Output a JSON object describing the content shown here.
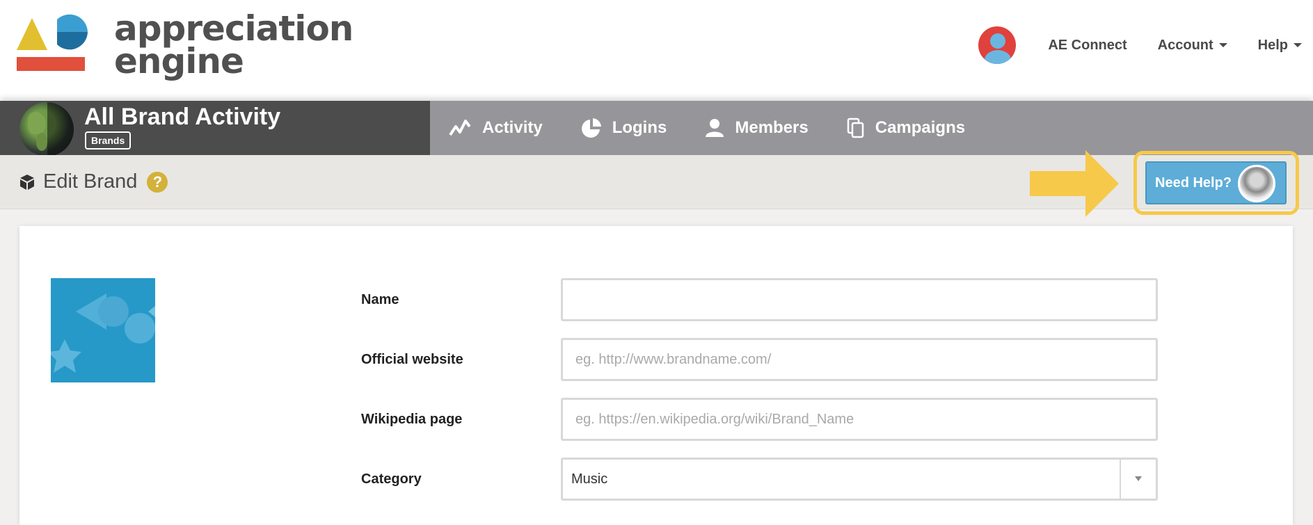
{
  "header": {
    "logo_line1": "appreciation",
    "logo_line2": "engine",
    "links": [
      {
        "label": "AE Connect",
        "caret": false
      },
      {
        "label": "Account",
        "caret": true
      },
      {
        "label": "Help",
        "caret": true
      }
    ]
  },
  "brand": {
    "title": "All Brand Activity",
    "badge": "Brands"
  },
  "nav": {
    "items": [
      {
        "label": "Activity",
        "icon": "activity-icon"
      },
      {
        "label": "Logins",
        "icon": "pie-chart-icon"
      },
      {
        "label": "Members",
        "icon": "person-icon"
      },
      {
        "label": "Campaigns",
        "icon": "copy-icon"
      }
    ]
  },
  "subheader": {
    "title": "Edit Brand",
    "help_glyph": "?",
    "need_help": "Need Help?"
  },
  "form": {
    "name_label": "Name",
    "name_value": "",
    "website_label": "Official website",
    "website_placeholder": "eg. http://www.brandname.com/",
    "wikipedia_label": "Wikipedia page",
    "wikipedia_placeholder": "eg. https://en.wikipedia.org/wiki/Brand_Name",
    "category_label": "Category",
    "category_value": "Music"
  },
  "colors": {
    "brand_bar": "#4c4c4c",
    "nav_bar": "#96969a",
    "accent_blue": "#5dadd8",
    "highlight_yellow": "#f7c94a",
    "help_gold": "#d4b13a",
    "avatar_red": "#e0413d"
  }
}
